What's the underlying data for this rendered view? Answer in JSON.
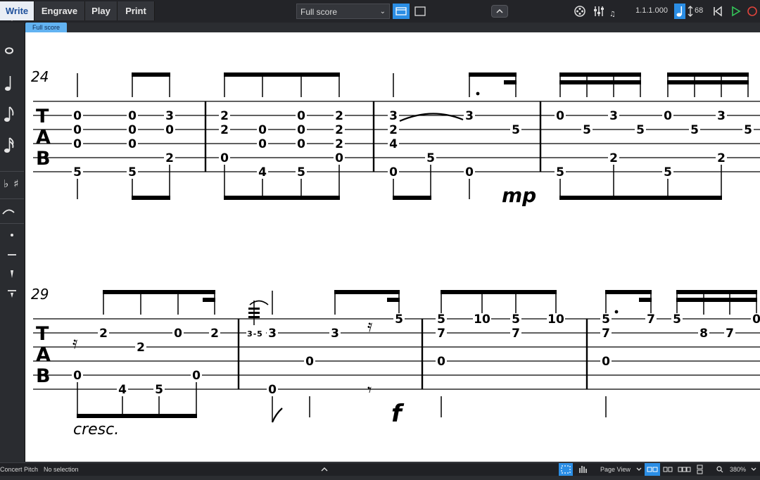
{
  "toolbar": {
    "modes": [
      "Write",
      "Engrave",
      "Play",
      "Print"
    ],
    "active_mode": "Write",
    "layout_select": "Full score",
    "position": "1.1.1.000",
    "tempo": "68",
    "accent_color": "#2b8ee5"
  },
  "page_tab": "Full score",
  "status": {
    "concert_pitch": "Concert Pitch",
    "selection": "No selection",
    "view_mode": "Page View",
    "zoom": "380%"
  },
  "left_panel_icons": [
    "whole-note-icon",
    "quarter-note-icon",
    "eighth-note-icon",
    "sixteenth-note-icon",
    "flat-icon",
    "sharp-icon",
    "slur-icon",
    "staccato-icon",
    "tenuto-icon",
    "staccatissimo-icon",
    "marcato-icon"
  ],
  "score": {
    "systems": [
      {
        "measure_number": "24",
        "tab_clef": [
          "T",
          "A",
          "B"
        ],
        "frets": [
          "0",
          "0",
          "0",
          "5",
          "0",
          "0",
          "0",
          "5",
          "3",
          "0",
          "2",
          "2",
          "2",
          "0",
          "2",
          "4",
          "0",
          "0",
          "0",
          "5",
          "2",
          "2",
          "2",
          "0",
          "3",
          "2",
          "4",
          "0",
          "5",
          "0",
          "3",
          "5",
          "0",
          "5",
          "5",
          "3",
          "2",
          "5",
          "0",
          "5",
          "5",
          "3",
          "2",
          "5"
        ],
        "dynamics": [
          "mp"
        ]
      },
      {
        "measure_number": "29",
        "tab_clef": [
          "T",
          "A",
          "B"
        ],
        "frets": [
          "2",
          "0",
          "2",
          "4",
          "5",
          "0",
          "0",
          "2",
          "3",
          "5",
          "3",
          "0",
          "0",
          "3",
          "5",
          "5",
          "7",
          "0",
          "10",
          "5",
          "7",
          "10",
          "5",
          "7",
          "0",
          "7",
          "5",
          "8",
          "7",
          "0"
        ],
        "dynamics": [
          "f"
        ],
        "expression": "cresc."
      }
    ]
  }
}
